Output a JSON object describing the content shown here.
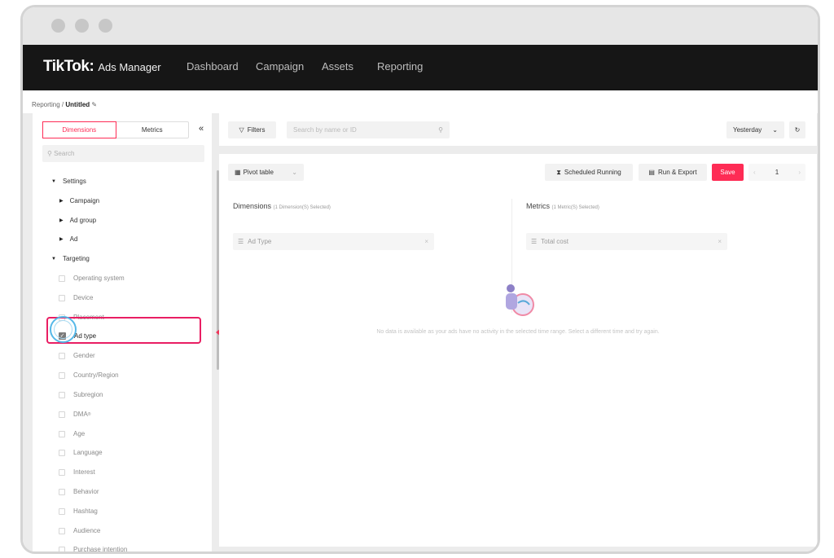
{
  "app": {
    "logo": "TikTok",
    "logo_suffix": ":",
    "subtitle": "Ads Manager"
  },
  "nav": [
    "Dashboard",
    "Campaign",
    "Assets",
    "Reporting"
  ],
  "breadcrumb": {
    "root": "Reporting",
    "separator": "/",
    "current": "Untitled"
  },
  "left": {
    "tabs": [
      "Dimensions",
      "Metrics"
    ],
    "collapse_label": "«",
    "search_placeholder": "Search",
    "groups": [
      {
        "label": "Settings",
        "children": [
          "Campaign",
          "Ad group",
          "Ad"
        ]
      },
      {
        "label": "Targeting",
        "options": [
          "Operating system",
          "Device",
          "Placement",
          "Ad type",
          "Gender",
          "Country/Region",
          "Subregion",
          "DMA",
          "Age",
          "Language",
          "Interest",
          "Behavior",
          "Hashtag",
          "Audience",
          "Purchase intention"
        ]
      }
    ],
    "checked_option": "Ad type",
    "dma_superscript": "®"
  },
  "toolbar": {
    "filters": "Filters",
    "search_placeholder": "Search by name or ID",
    "date_range": "Yesterday"
  },
  "report": {
    "view": "Pivot table",
    "scheduled": "Scheduled Running",
    "run_export": "Run & Export",
    "save": "Save",
    "page": "1",
    "prev": "‹",
    "next": "›",
    "dimensions_title": "Dimensions",
    "dimensions_count": "(1 Dimension(S) Selected)",
    "metrics_title": "Metrics",
    "metrics_count": "(1 Metric(S) Selected)",
    "dimension_chip": "Ad Type",
    "metric_chip": "Total cost",
    "empty_message": "No data is available as your ads have no activity in the selected time range. Select a different time and try again."
  },
  "colors": {
    "accent": "#fe2c55",
    "topbar": "#161616",
    "highlight": "#e91e63",
    "ring": "#55b8e8"
  }
}
